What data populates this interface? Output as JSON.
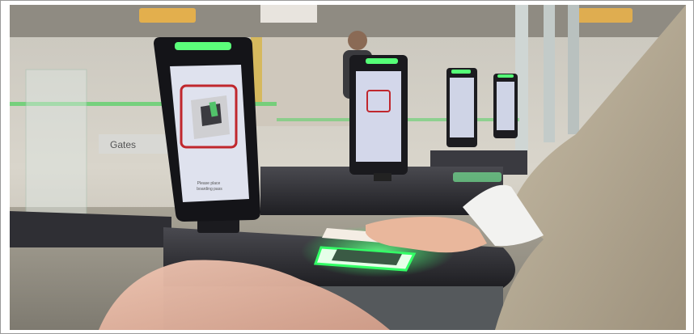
{
  "scene": {
    "subject": "traveller-hand-on-boarding-pass-scanner-at-airport-e-gate",
    "screen_caption_line1": "Please place",
    "screen_caption_line2": "boarding pass",
    "wall_sign_text": "Gates"
  },
  "colors": {
    "scanner_glow": "#33ff66",
    "screen_background": "#dfe2ee",
    "screen_icon_border": "#c0272d",
    "gate_body": "#2b2b2f",
    "sleeve_beige": "#b7ab94",
    "cuff_white": "#f2f2f0",
    "foreground_sleeve_pink": "#e6b6a2"
  }
}
